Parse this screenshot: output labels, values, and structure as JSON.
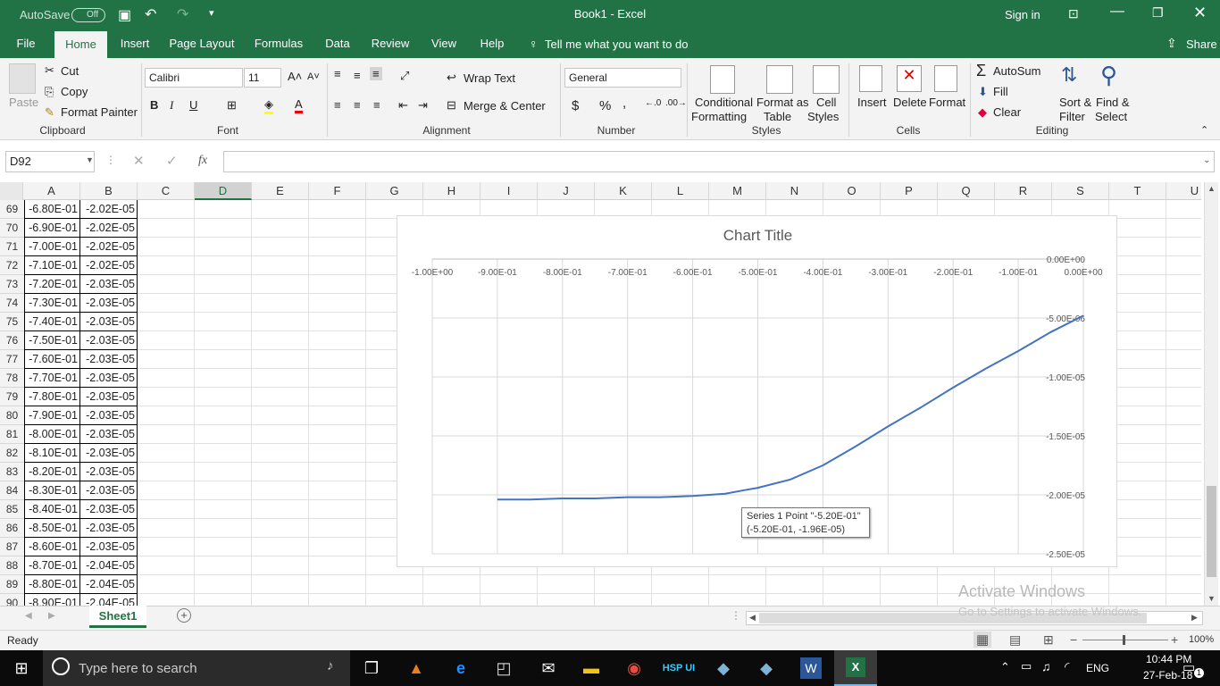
{
  "titlebar": {
    "autosave": "AutoSave",
    "autosave_state": "Off",
    "title": "Book1  -  Excel",
    "signin": "Sign in"
  },
  "tabs": [
    "File",
    "Home",
    "Insert",
    "Page Layout",
    "Formulas",
    "Data",
    "Review",
    "View",
    "Help"
  ],
  "tell_me": "Tell me what you want to do",
  "share": "Share",
  "clipboard": {
    "paste": "Paste",
    "cut": "Cut",
    "copy": "Copy",
    "format_painter": "Format Painter",
    "group": "Clipboard"
  },
  "font": {
    "name": "Calibri",
    "size": "11",
    "bold": "B",
    "italic": "I",
    "underline": "U",
    "group": "Font"
  },
  "alignment": {
    "wrap": "Wrap Text",
    "merge": "Merge & Center",
    "group": "Alignment"
  },
  "number": {
    "format": "General",
    "currency": "$",
    "percent": "%",
    "comma": ",",
    "group": "Number"
  },
  "styles": {
    "conditional": "Conditional",
    "conditional2": "Formatting",
    "format_table": "Format as",
    "format_table2": "Table",
    "cell_styles": "Cell",
    "cell_styles2": "Styles",
    "group": "Styles"
  },
  "cells": {
    "insert": "Insert",
    "delete": "Delete",
    "format": "Format",
    "group": "Cells"
  },
  "editing": {
    "autosum": "AutoSum",
    "fill": "Fill",
    "clear": "Clear",
    "sort": "Sort &",
    "sort2": "Filter",
    "find": "Find &",
    "find2": "Select",
    "group": "Editing"
  },
  "formula_bar": {
    "name_box": "D92",
    "fx": "fx",
    "value": ""
  },
  "columns": [
    "A",
    "B",
    "C",
    "D",
    "E",
    "F",
    "G",
    "H",
    "I",
    "J",
    "K",
    "L",
    "M",
    "N",
    "O",
    "P",
    "Q",
    "R",
    "S",
    "T",
    "U"
  ],
  "rows": [
    {
      "n": "69",
      "a": "-6.80E-01",
      "b": "-2.02E-05"
    },
    {
      "n": "70",
      "a": "-6.90E-01",
      "b": "-2.02E-05"
    },
    {
      "n": "71",
      "a": "-7.00E-01",
      "b": "-2.02E-05"
    },
    {
      "n": "72",
      "a": "-7.10E-01",
      "b": "-2.02E-05"
    },
    {
      "n": "73",
      "a": "-7.20E-01",
      "b": "-2.03E-05"
    },
    {
      "n": "74",
      "a": "-7.30E-01",
      "b": "-2.03E-05"
    },
    {
      "n": "75",
      "a": "-7.40E-01",
      "b": "-2.03E-05"
    },
    {
      "n": "76",
      "a": "-7.50E-01",
      "b": "-2.03E-05"
    },
    {
      "n": "77",
      "a": "-7.60E-01",
      "b": "-2.03E-05"
    },
    {
      "n": "78",
      "a": "-7.70E-01",
      "b": "-2.03E-05"
    },
    {
      "n": "79",
      "a": "-7.80E-01",
      "b": "-2.03E-05"
    },
    {
      "n": "80",
      "a": "-7.90E-01",
      "b": "-2.03E-05"
    },
    {
      "n": "81",
      "a": "-8.00E-01",
      "b": "-2.03E-05"
    },
    {
      "n": "82",
      "a": "-8.10E-01",
      "b": "-2.03E-05"
    },
    {
      "n": "83",
      "a": "-8.20E-01",
      "b": "-2.03E-05"
    },
    {
      "n": "84",
      "a": "-8.30E-01",
      "b": "-2.03E-05"
    },
    {
      "n": "85",
      "a": "-8.40E-01",
      "b": "-2.03E-05"
    },
    {
      "n": "86",
      "a": "-8.50E-01",
      "b": "-2.03E-05"
    },
    {
      "n": "87",
      "a": "-8.60E-01",
      "b": "-2.03E-05"
    },
    {
      "n": "88",
      "a": "-8.70E-01",
      "b": "-2.04E-05"
    },
    {
      "n": "89",
      "a": "-8.80E-01",
      "b": "-2.04E-05"
    },
    {
      "n": "90",
      "a": "-8.90E-01",
      "b": "-2.04E-05"
    }
  ],
  "chart_data": {
    "type": "line",
    "title": "Chart Title",
    "x_ticks": [
      "-1.00E+00",
      "-9.00E-01",
      "-8.00E-01",
      "-7.00E-01",
      "-6.00E-01",
      "-5.00E-01",
      "-4.00E-01",
      "-3.00E-01",
      "-2.00E-01",
      "-1.00E-01",
      "0.00E+00"
    ],
    "y_ticks": [
      "0.00E+00",
      "-5.00E-06",
      "-1.00E-05",
      "-1.50E-05",
      "-2.00E-05",
      "-2.50E-05"
    ],
    "xlim": [
      -1.0,
      0.0
    ],
    "ylim": [
      -2.5e-05,
      0.0
    ],
    "grid": true,
    "series": [
      {
        "color": "#4472c4",
        "x": [
          -0.9,
          -0.85,
          -0.8,
          -0.75,
          -0.7,
          -0.65,
          -0.6,
          -0.55,
          -0.52,
          -0.5,
          -0.45,
          -0.4,
          -0.35,
          -0.3,
          -0.25,
          -0.2,
          -0.15,
          -0.1,
          -0.05,
          0.0
        ],
        "y": [
          -2.04e-05,
          -2.04e-05,
          -2.03e-05,
          -2.03e-05,
          -2.02e-05,
          -2.02e-05,
          -2.01e-05,
          -1.99e-05,
          -1.96e-05,
          -1.94e-05,
          -1.87e-05,
          -1.75e-05,
          -1.59e-05,
          -1.42e-05,
          -1.26e-05,
          -1.09e-05,
          -9.3e-06,
          -7.8e-06,
          -6.2e-06,
          -4.8e-06
        ]
      }
    ]
  },
  "tooltip": {
    "line1": "Series 1 Point \"-5.20E-01\"",
    "line2": "(-5.20E-01, -1.96E-05)"
  },
  "sheet_tab": "Sheet1",
  "status": {
    "ready": "Ready",
    "zoom": "100%"
  },
  "watermark": {
    "line1": "Activate Windows",
    "line2": "Go to Settings to activate Windows."
  },
  "taskbar": {
    "search": "Type here to search",
    "lang": "ENG",
    "time": "10:44 PM",
    "date": "27-Feb-18",
    "notif": "1"
  }
}
